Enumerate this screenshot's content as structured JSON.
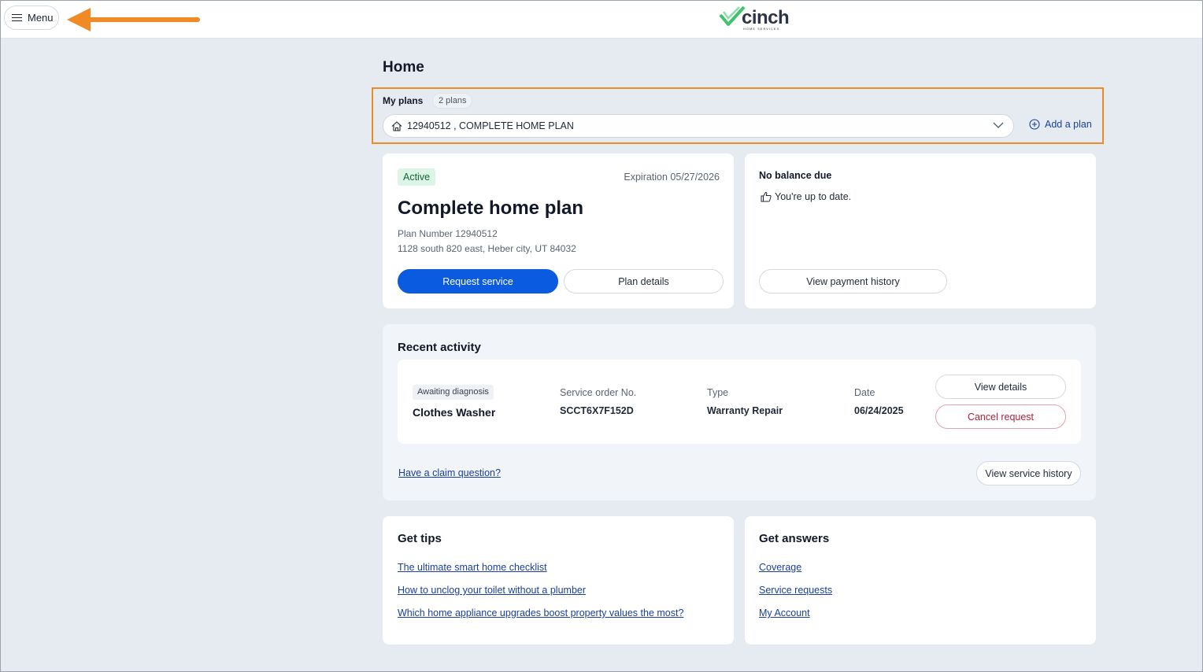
{
  "header": {
    "menu_label": "Menu",
    "logo_text": "cinch",
    "logo_subtext": "HOME SERVICES",
    "colors": {
      "annotation_arrow": "#f08a24",
      "logo_check": "#3ec46d"
    }
  },
  "page": {
    "title": "Home"
  },
  "plans": {
    "label": "My plans",
    "count_badge": "2 plans",
    "selected_plan": "12940512 , COMPLETE HOME PLAN",
    "add_plan_label": "Add a plan"
  },
  "plan_card": {
    "status": "Active",
    "expiration": "Expiration 05/27/2026",
    "title": "Complete home plan",
    "plan_number": "Plan Number 12940512",
    "address": "1128 south 820 east, Heber city, UT 84032",
    "request_service_label": "Request service",
    "plan_details_label": "Plan details"
  },
  "balance_card": {
    "title": "No balance due",
    "subtitle": "You're up to date.",
    "payment_history_label": "View payment history"
  },
  "recent_activity": {
    "title": "Recent activity",
    "item": {
      "status": "Awaiting diagnosis",
      "name": "Clothes Washer",
      "service_order_label": "Service order No.",
      "service_order_value": "SCCT6X7F152D",
      "type_label": "Type",
      "type_value": "Warranty Repair",
      "date_label": "Date",
      "date_value": "06/24/2025",
      "view_details_label": "View details",
      "cancel_label": "Cancel request"
    },
    "claim_question_link": "Have a claim question?",
    "service_history_label": "View service history"
  },
  "tips": {
    "title": "Get tips",
    "links": [
      "The ultimate smart home checklist",
      "How to unclog your toilet without a plumber",
      "Which home appliance upgrades boost property values the most?"
    ]
  },
  "answers": {
    "title": "Get answers",
    "links": [
      "Coverage",
      "Service requests",
      "My Account"
    ]
  }
}
